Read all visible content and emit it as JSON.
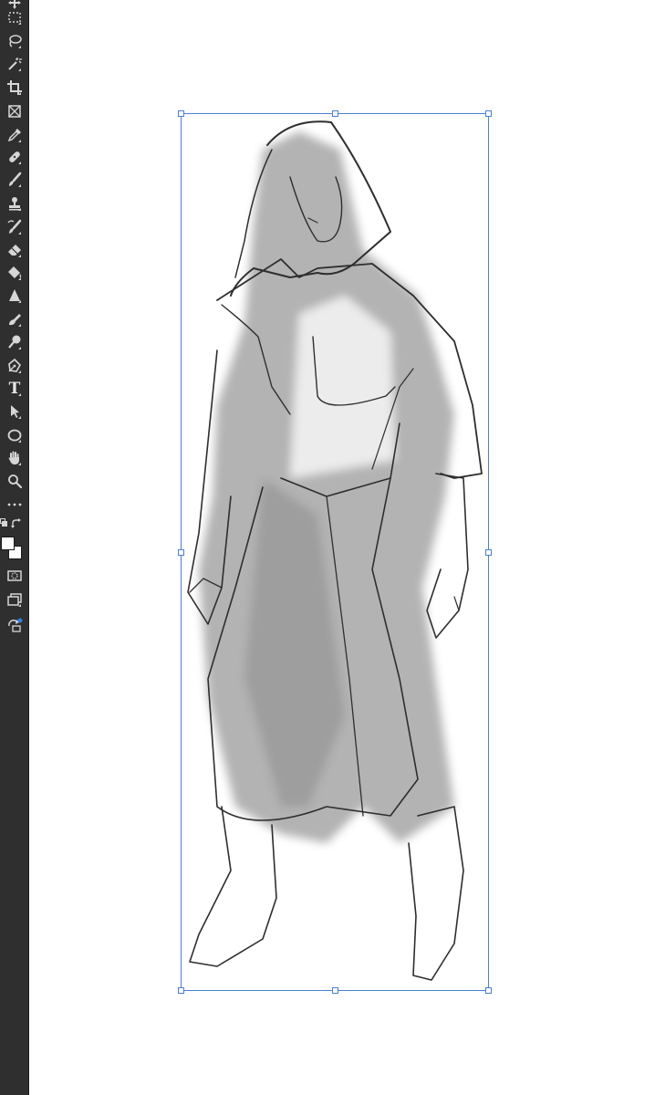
{
  "toolbar": {
    "tools": [
      {
        "name": "move-tool",
        "icon": "move-icon"
      },
      {
        "name": "marquee-tool",
        "icon": "rect-marquee-icon"
      },
      {
        "name": "lasso-tool",
        "icon": "lasso-icon"
      },
      {
        "name": "magic-wand-tool",
        "icon": "magic-wand-icon"
      },
      {
        "name": "crop-tool",
        "icon": "crop-icon"
      },
      {
        "name": "frame-tool",
        "icon": "frame-icon"
      },
      {
        "name": "eyedropper-tool",
        "icon": "eyedropper-icon"
      },
      {
        "name": "healing-brush-tool",
        "icon": "bandage-icon"
      },
      {
        "name": "brush-tool",
        "icon": "brush-icon"
      },
      {
        "name": "clone-stamp-tool",
        "icon": "stamp-icon"
      },
      {
        "name": "history-brush-tool",
        "icon": "history-brush-icon"
      },
      {
        "name": "eraser-tool",
        "icon": "eraser-icon"
      },
      {
        "name": "paint-bucket-tool",
        "icon": "paint-bucket-icon"
      },
      {
        "name": "blur-tool",
        "icon": "blur-icon"
      },
      {
        "name": "smudge-tool",
        "icon": "smudge-icon"
      },
      {
        "name": "dodge-tool",
        "icon": "dodge-icon"
      },
      {
        "name": "pen-tool",
        "icon": "pen-icon"
      },
      {
        "name": "type-tool",
        "icon": "type-icon",
        "label": "T"
      },
      {
        "name": "path-selection-tool",
        "icon": "arrow-icon"
      },
      {
        "name": "ellipse-tool",
        "icon": "ellipse-icon"
      },
      {
        "name": "hand-tool",
        "icon": "hand-icon"
      },
      {
        "name": "zoom-tool",
        "icon": "zoom-icon"
      },
      {
        "name": "edit-toolbar-button",
        "icon": "more-icon"
      }
    ],
    "foreground_color": "#ffffff",
    "background_color": "#ffffff",
    "quick_mask_icon": "quick-mask-icon",
    "screen_mode_icon": "screen-mode-icon",
    "content_aware_icon": "content-aware-icon"
  },
  "canvas": {
    "background": "#ffffff",
    "selection_color": "#4a7fd6",
    "artwork": "pencil-sketch-hooded-figure"
  }
}
